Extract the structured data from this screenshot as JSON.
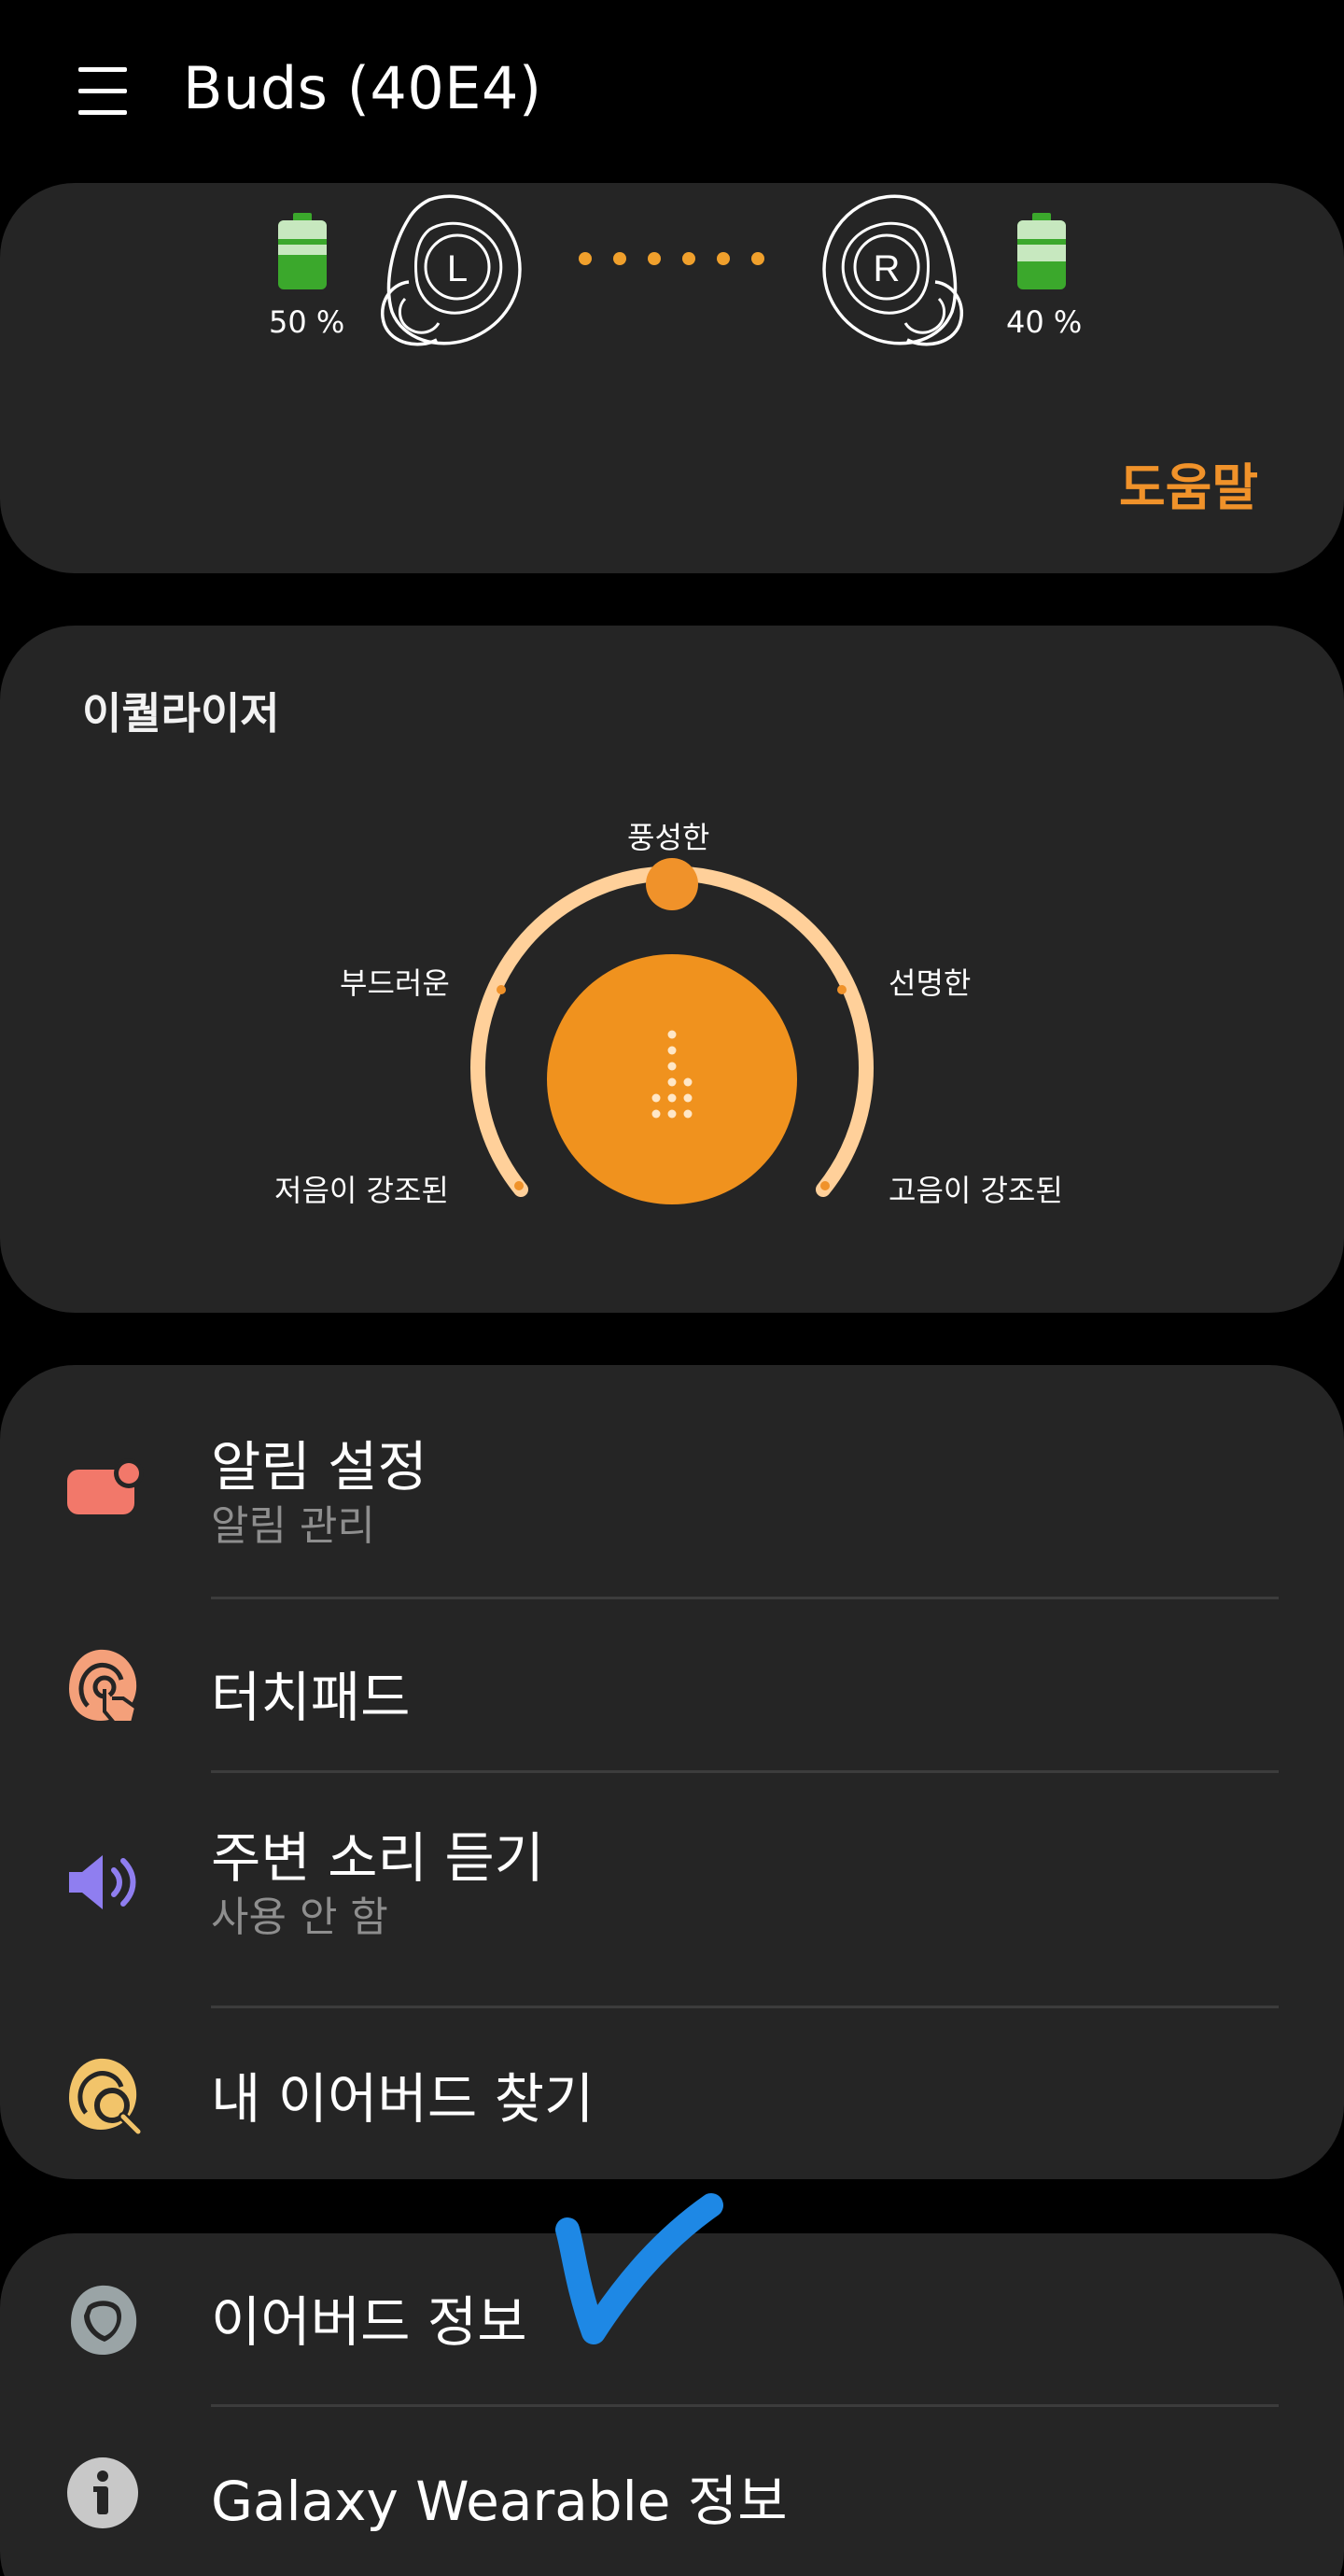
{
  "header": {
    "title": "Buds (40E4)",
    "menu_icon": "hamburger-menu-icon"
  },
  "buds": {
    "left": {
      "letter": "L",
      "battery_text": "50 %",
      "battery_level": 50
    },
    "right": {
      "letter": "R",
      "battery_text": "40 %",
      "battery_level": 40
    },
    "help_label": "도움말"
  },
  "equalizer": {
    "title": "이퀄라이저",
    "selected_preset": "풍성한",
    "presets": {
      "bass_boost": "저음이 강조된",
      "soft": "부드러운",
      "dynamic": "풍성한",
      "clear": "선명한",
      "treble_boost": "고음이 강조된"
    }
  },
  "settings": {
    "notifications": {
      "title": "알림 설정",
      "subtitle": "알림 관리"
    },
    "touchpad": {
      "title": "터치패드"
    },
    "ambient": {
      "title": "주변 소리 듣기",
      "subtitle": "사용 안 함"
    },
    "find": {
      "title": "내 이어버드 찾기"
    }
  },
  "about": {
    "earbuds": {
      "title": "이어버드 정보"
    },
    "wearable": {
      "title": "Galaxy Wearable 정보"
    }
  },
  "colors": {
    "accent_orange": "#f0922a",
    "card_bg": "#252525",
    "battery_green": "#3ba82c",
    "check_blue": "#1e88e5"
  }
}
